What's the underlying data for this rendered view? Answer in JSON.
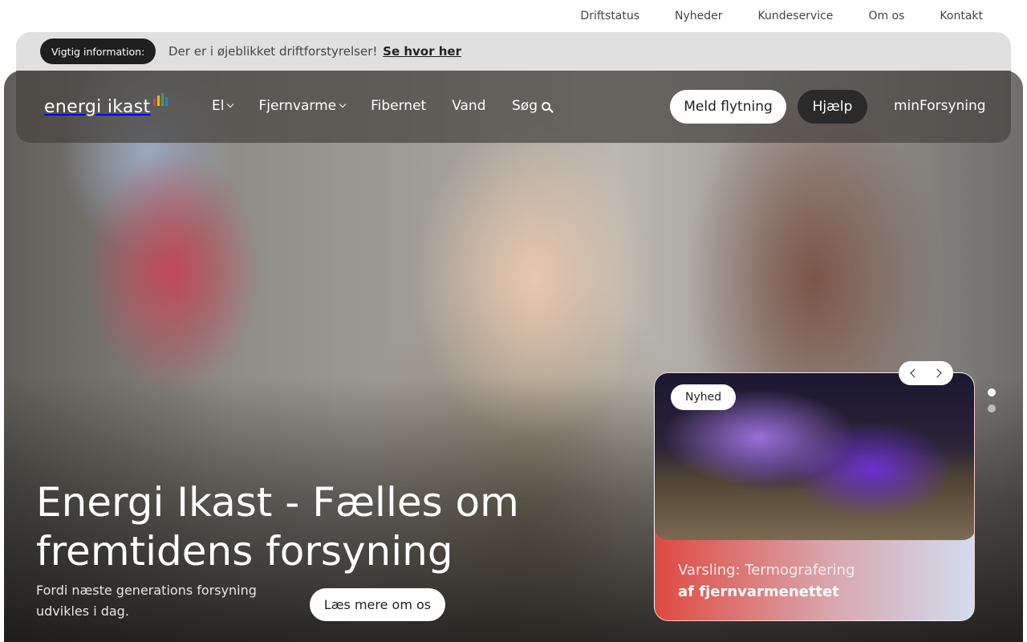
{
  "utility_nav": [
    "Driftstatus",
    "Nyheder",
    "Kundeservice",
    "Om os",
    "Kontakt"
  ],
  "info_banner": {
    "label": "Vigtig information:",
    "text": "Der er i øjeblikket driftforstyrelser!",
    "link": "Se hvor her"
  },
  "header": {
    "logo_text": "energi ikast",
    "logo_bar_colors": [
      "#e8412c",
      "#f5b800",
      "#3aa45c",
      "#2f7bd8"
    ],
    "nav": [
      "El",
      "Fjernvarme",
      "Fibernet",
      "Vand"
    ],
    "search_label": "Søg",
    "move_button": "Meld flytning",
    "help_button": "Hjælp",
    "account_link": "minForsyning"
  },
  "hero": {
    "title": "Energi Ikast - Fælles om fremtidens forsyning",
    "subtitle": "Fordi næste generations forsyning udvikles i dag.",
    "cta": "Læs mere om os"
  },
  "news_card": {
    "badge": "Nyhed",
    "title_line1": "Varsling: Termografering",
    "title_line2": "af fjernvarmenettet"
  },
  "carousel": {
    "slides": 2,
    "active": 1
  }
}
